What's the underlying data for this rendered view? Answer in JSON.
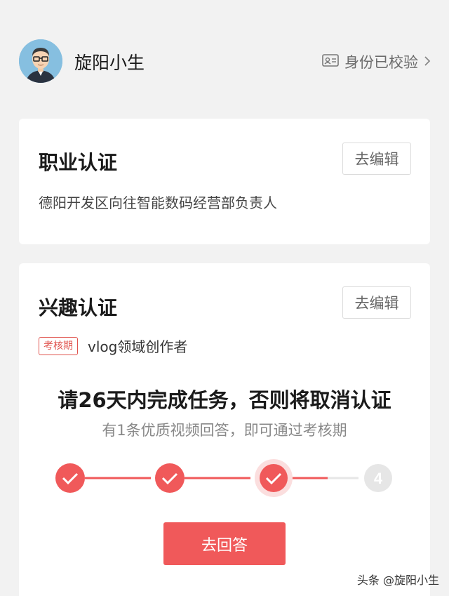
{
  "profile": {
    "name": "旋阳小生",
    "verify_label": "身份已校验",
    "avatar_icon": "avatar-cartoon-man"
  },
  "occupation_card": {
    "title": "职业认证",
    "edit_label": "去编辑",
    "description": "德阳开发区向往智能数码经营部负责人"
  },
  "interest_card": {
    "title": "兴趣认证",
    "edit_label": "去编辑",
    "badge": "考核期",
    "field": "vlog领域创作者",
    "task_headline": "请26天内完成任务，否则将取消认证",
    "task_hint": "有1条优质视频回答，即可通过考核期",
    "steps": [
      {
        "label": "",
        "state": "done"
      },
      {
        "label": "",
        "state": "done"
      },
      {
        "label": "",
        "state": "current"
      },
      {
        "label": "4",
        "state": "todo"
      }
    ],
    "progress_fraction": 0.67,
    "answer_button": "去回答"
  },
  "watermark": "头条 @旋阳小生",
  "colors": {
    "accent": "#f0595a",
    "inactive": "#e6e6e6",
    "background": "#f2f2f2"
  }
}
